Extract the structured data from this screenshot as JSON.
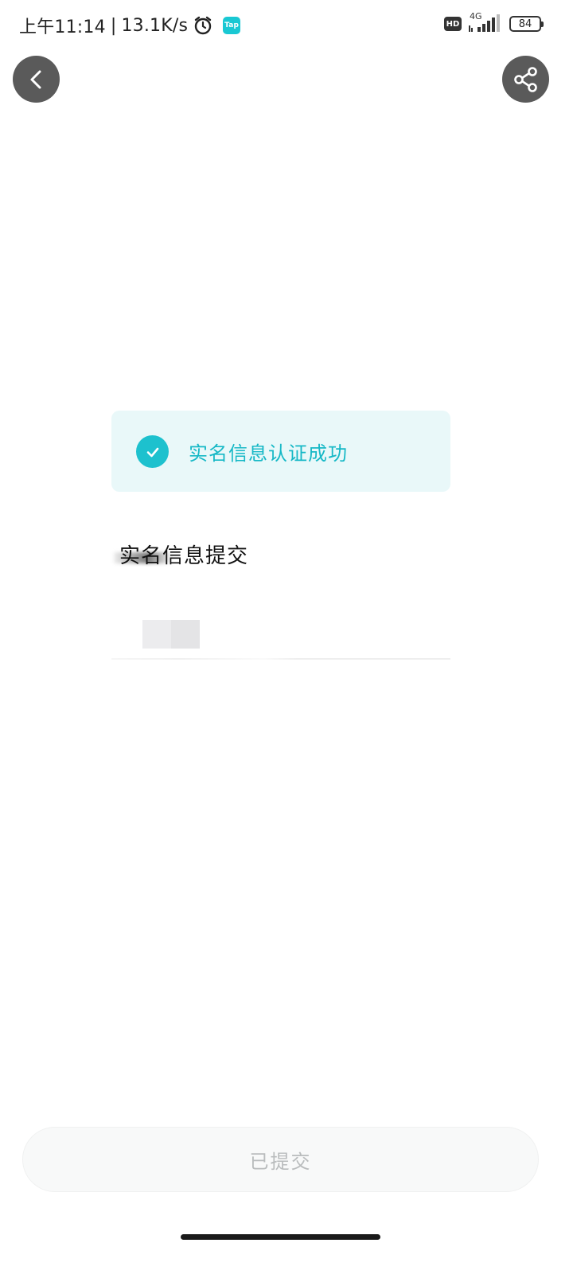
{
  "status_bar": {
    "time": "上午11:14",
    "separator": "|",
    "net_speed": "13.1K/s",
    "tap_label": "Tap",
    "hd_label": "HD",
    "network_type": "4G",
    "battery": "84",
    "icons": [
      "alarm-icon",
      "tap-app-icon",
      "hd-icon",
      "signal-icon",
      "battery-icon"
    ]
  },
  "nav": {
    "back_icon": "chevron-left-icon",
    "share_icon": "share-icon"
  },
  "success": {
    "icon": "check-icon",
    "text": "实名信息认证成功",
    "accent_color": "#1dc1ce"
  },
  "section": {
    "title": "实名信息提交"
  },
  "action": {
    "submitted_label": "已提交"
  }
}
